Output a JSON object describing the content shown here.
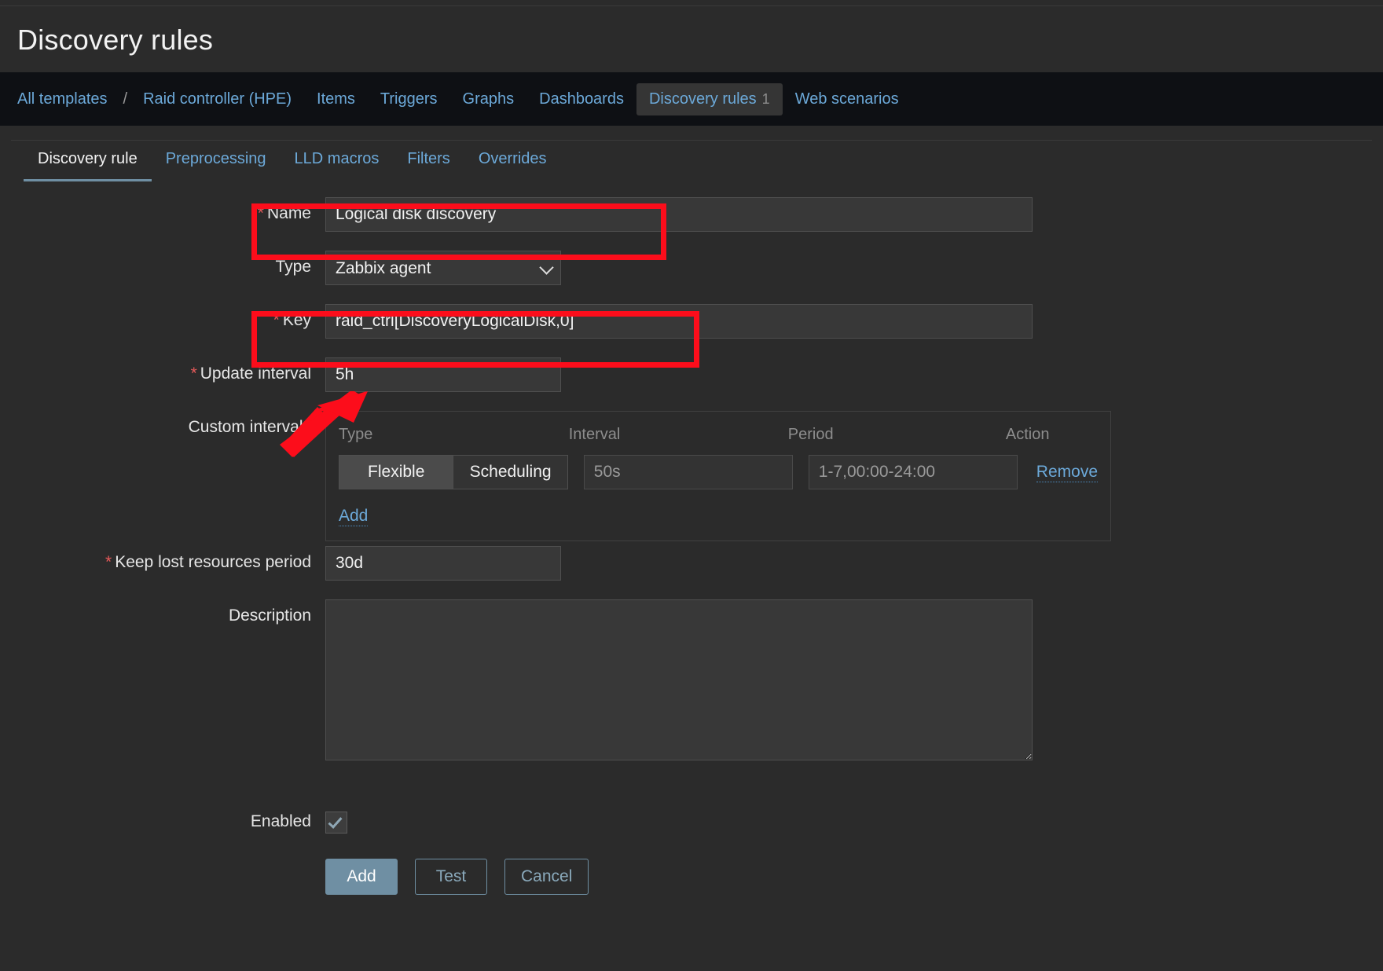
{
  "header": {
    "title": "Discovery rules"
  },
  "nav": {
    "items": [
      {
        "label": "All templates",
        "active": false
      },
      {
        "label": "Raid controller (HPE)",
        "active": false
      },
      {
        "label": "Items",
        "active": false
      },
      {
        "label": "Triggers",
        "active": false
      },
      {
        "label": "Graphs",
        "active": false
      },
      {
        "label": "Dashboards",
        "active": false
      },
      {
        "label": "Discovery rules",
        "count": "1",
        "active": true
      },
      {
        "label": "Web scenarios",
        "active": false
      }
    ],
    "separator": "/"
  },
  "subtabs": [
    {
      "label": "Discovery rule",
      "active": true
    },
    {
      "label": "Preprocessing",
      "active": false
    },
    {
      "label": "LLD macros",
      "active": false
    },
    {
      "label": "Filters",
      "active": false
    },
    {
      "label": "Overrides",
      "active": false
    }
  ],
  "form": {
    "name": {
      "label": "Name",
      "required": "*",
      "value": "Logical disk discovery",
      "placeholder": ""
    },
    "type": {
      "label": "Type",
      "value": "Zabbix agent",
      "options": [
        "Zabbix agent"
      ]
    },
    "key": {
      "label": "Key",
      "required": "*",
      "value": "raid_ctrl[DiscoveryLogicalDisk,0]",
      "placeholder": ""
    },
    "update_interval": {
      "label": "Update interval",
      "required": "*",
      "value": "5h",
      "placeholder": ""
    },
    "custom_intervals": {
      "label": "Custom intervals",
      "columns": [
        "Type",
        "Interval",
        "Period",
        "Action"
      ],
      "rows": [
        {
          "type_flexible": "Flexible",
          "type_scheduling": "Scheduling",
          "type_selected": "Flexible",
          "interval": "50s",
          "period": "1-7,00:00-24:00",
          "action": "Remove"
        }
      ],
      "add_label": "Add"
    },
    "keep_lost": {
      "label": "Keep lost resources period",
      "required": "*",
      "value": "30d",
      "placeholder": ""
    },
    "description": {
      "label": "Description",
      "value": "",
      "placeholder": ""
    },
    "enabled": {
      "label": "Enabled",
      "checked": true
    },
    "buttons": [
      {
        "label": "Add",
        "style": "primary"
      },
      {
        "label": "Test",
        "style": "ghost"
      },
      {
        "label": "Cancel",
        "style": "ghost"
      }
    ]
  },
  "annotations": {
    "highlight_name": "name-field-highlight",
    "highlight_key": "key-field-highlight",
    "arrow": "update-interval-arrow"
  },
  "colors": {
    "accent_link": "#6ca9d9",
    "required_star": "#e45959",
    "annotation": "#fc0d1b",
    "primary_button": "#6f8fa3",
    "panel_bg": "#2b2b2b",
    "navbar_bg": "#0e1014",
    "input_bg": "#383838"
  }
}
